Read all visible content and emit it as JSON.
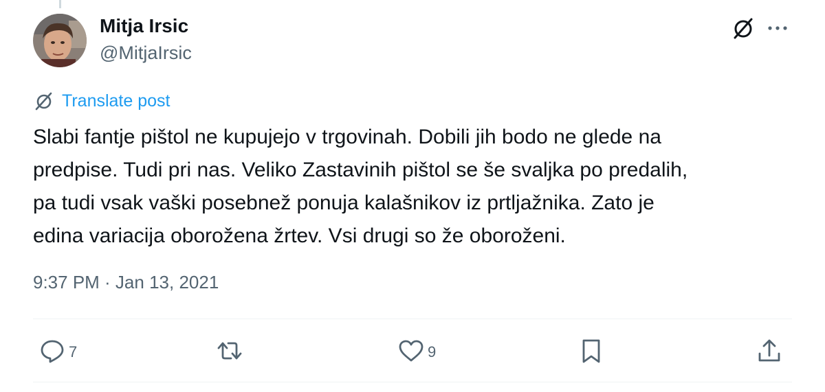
{
  "author": {
    "name": "Mitja Irsic",
    "handle": "@MitjaIrsic"
  },
  "icons": {
    "top_translate": "translate-icon",
    "more": "more-icon",
    "translate": "translate-icon",
    "reply": "reply-icon",
    "retweet": "retweet-icon",
    "like": "heart-icon",
    "bookmark": "bookmark-icon",
    "share": "share-icon"
  },
  "translate_label": "Translate post",
  "post": {
    "lines": [
      "Slabi fantje pištol ne kupujejo v trgovinah. Dobili jih bodo ne glede na",
      "predpise. Tudi pri nas. Veliko Zastavinih pištol se še svaljka po predalih,",
      "pa tudi vsak vaški posebnež ponuja kalašnikov iz prtljažnika. Zato je",
      "edina variacija oborožena žrtev. Vsi drugi so že oboroženi."
    ]
  },
  "timestamp": "9:37 PM · Jan 13, 2021",
  "actions": {
    "reply_count": "7",
    "retweet_count": "",
    "like_count": "9"
  },
  "colors": {
    "text": "#0f1419",
    "secondary": "#536471",
    "link": "#1d9bf0",
    "divider": "#eff3f4"
  }
}
